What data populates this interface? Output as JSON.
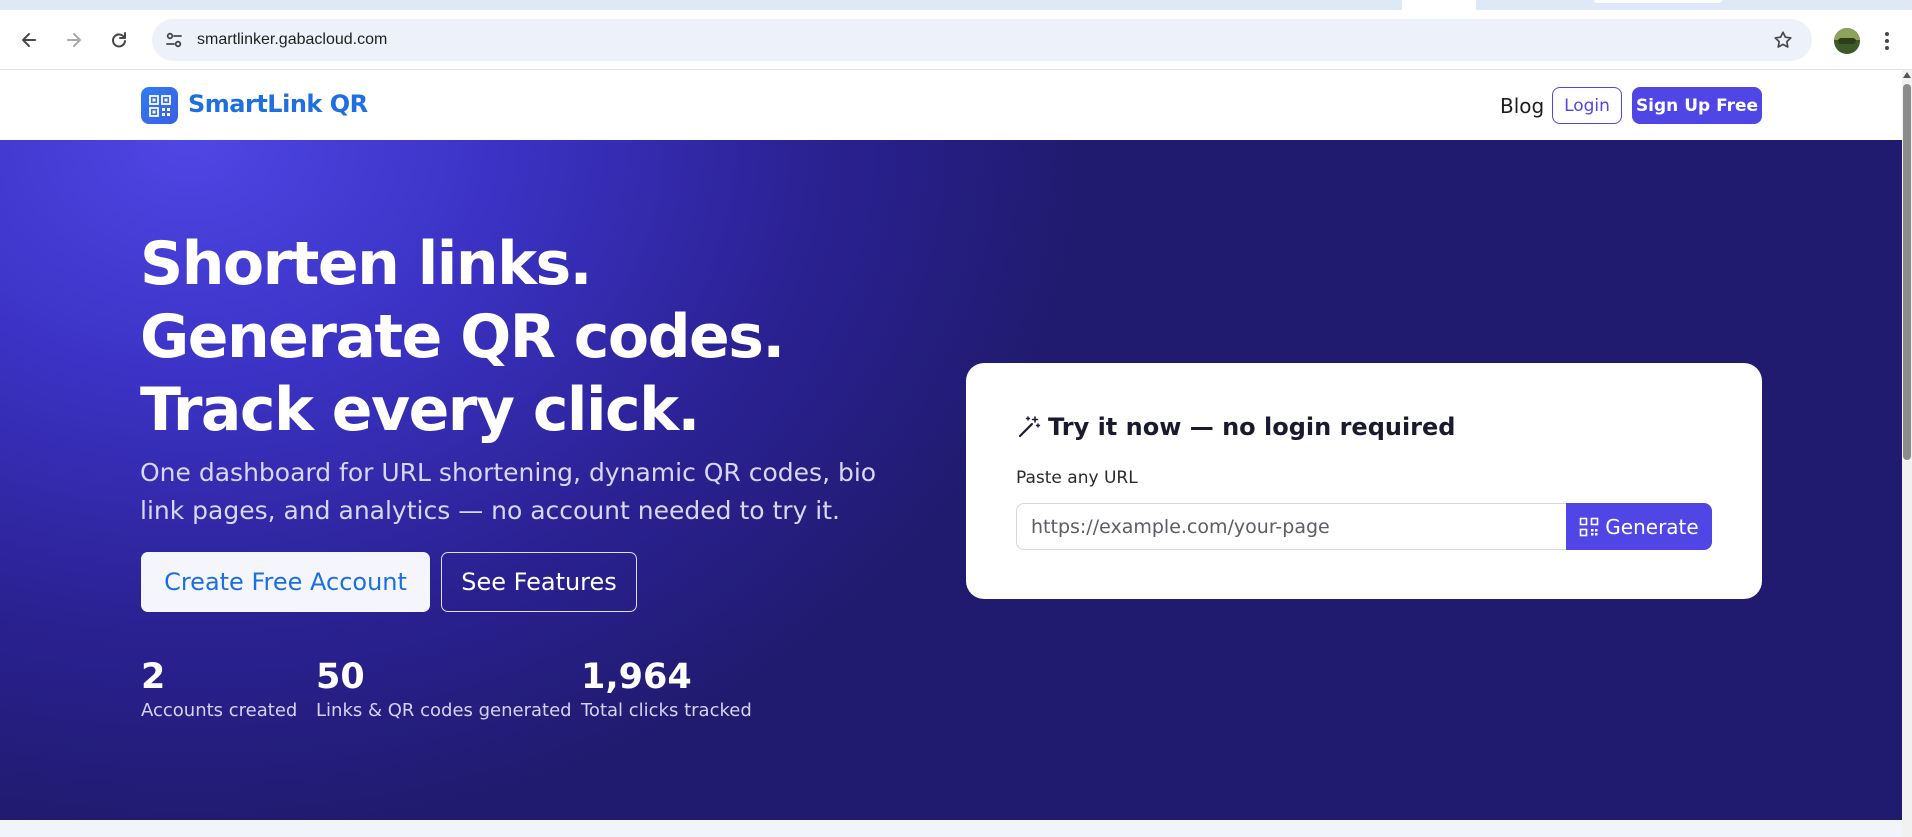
{
  "browser": {
    "url": "smartlinker.gabacloud.com",
    "icons": {
      "back": "arrow-left-icon",
      "forward": "arrow-right-icon",
      "reload": "reload-icon",
      "site_info": "tune-icon",
      "bookmark": "star-icon",
      "menu": "kebab-icon"
    }
  },
  "header": {
    "brand": "SmartLink QR",
    "nav": {
      "blog": "Blog",
      "login": "Login",
      "signup": "Sign Up Free"
    }
  },
  "hero": {
    "title": "Shorten links. Generate QR codes. Track every click.",
    "subtitle": "One dashboard for URL shortening, dynamic QR codes, bio link pages, and analytics — no account needed to try it.",
    "cta_primary": "Create Free Account",
    "cta_secondary": "See Features",
    "stats": [
      {
        "value": "2",
        "label": "Accounts created"
      },
      {
        "value": "50",
        "label": "Links & QR codes generated"
      },
      {
        "value": "1,964",
        "label": "Total clicks tracked"
      }
    ]
  },
  "try_card": {
    "title": "Try it now — no login required",
    "field_label": "Paste any URL",
    "placeholder": "https://example.com/your-page",
    "button": "Generate"
  },
  "colors": {
    "accent": "#4f46e5",
    "brand_blue": "#1f6fe0",
    "hero_dark": "#201b6e"
  }
}
